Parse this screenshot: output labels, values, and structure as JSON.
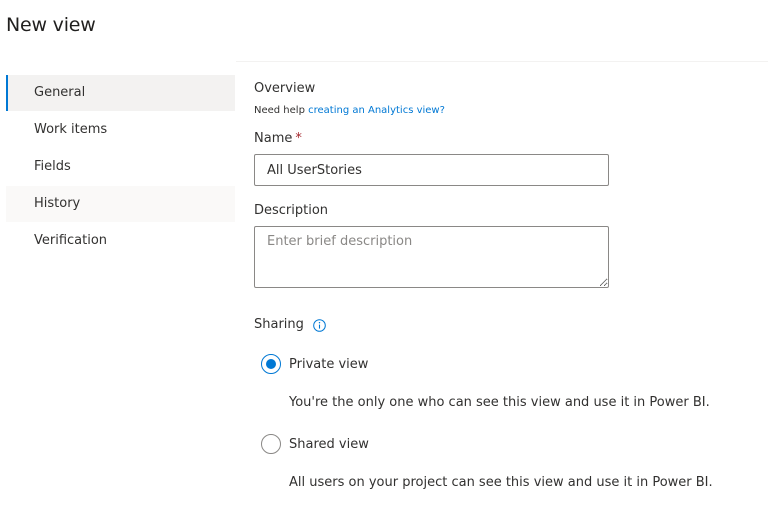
{
  "page": {
    "title": "New view"
  },
  "nav": {
    "items": [
      {
        "label": "General"
      },
      {
        "label": "Work items"
      },
      {
        "label": "Fields"
      },
      {
        "label": "History"
      },
      {
        "label": "Verification"
      }
    ],
    "selected": "General"
  },
  "overview": {
    "heading": "Overview",
    "help_prefix": "Need help ",
    "help_link": "creating an Analytics view?"
  },
  "name_field": {
    "label": "Name",
    "required_mark": "*",
    "value": "All UserStories"
  },
  "description_field": {
    "label": "Description",
    "placeholder": "Enter brief description",
    "value": ""
  },
  "sharing": {
    "label": "Sharing",
    "info_icon": "info-icon",
    "options": [
      {
        "label": "Private view",
        "description": "You're the only one who can see this view and use it in Power BI.",
        "checked": true
      },
      {
        "label": "Shared view",
        "description": "All users on your project can see this view and use it in Power BI.",
        "checked": false
      }
    ]
  },
  "colors": {
    "accent": "#0078d4",
    "required": "#a4262c",
    "selected_nav_bg": "#f3f2f1"
  }
}
